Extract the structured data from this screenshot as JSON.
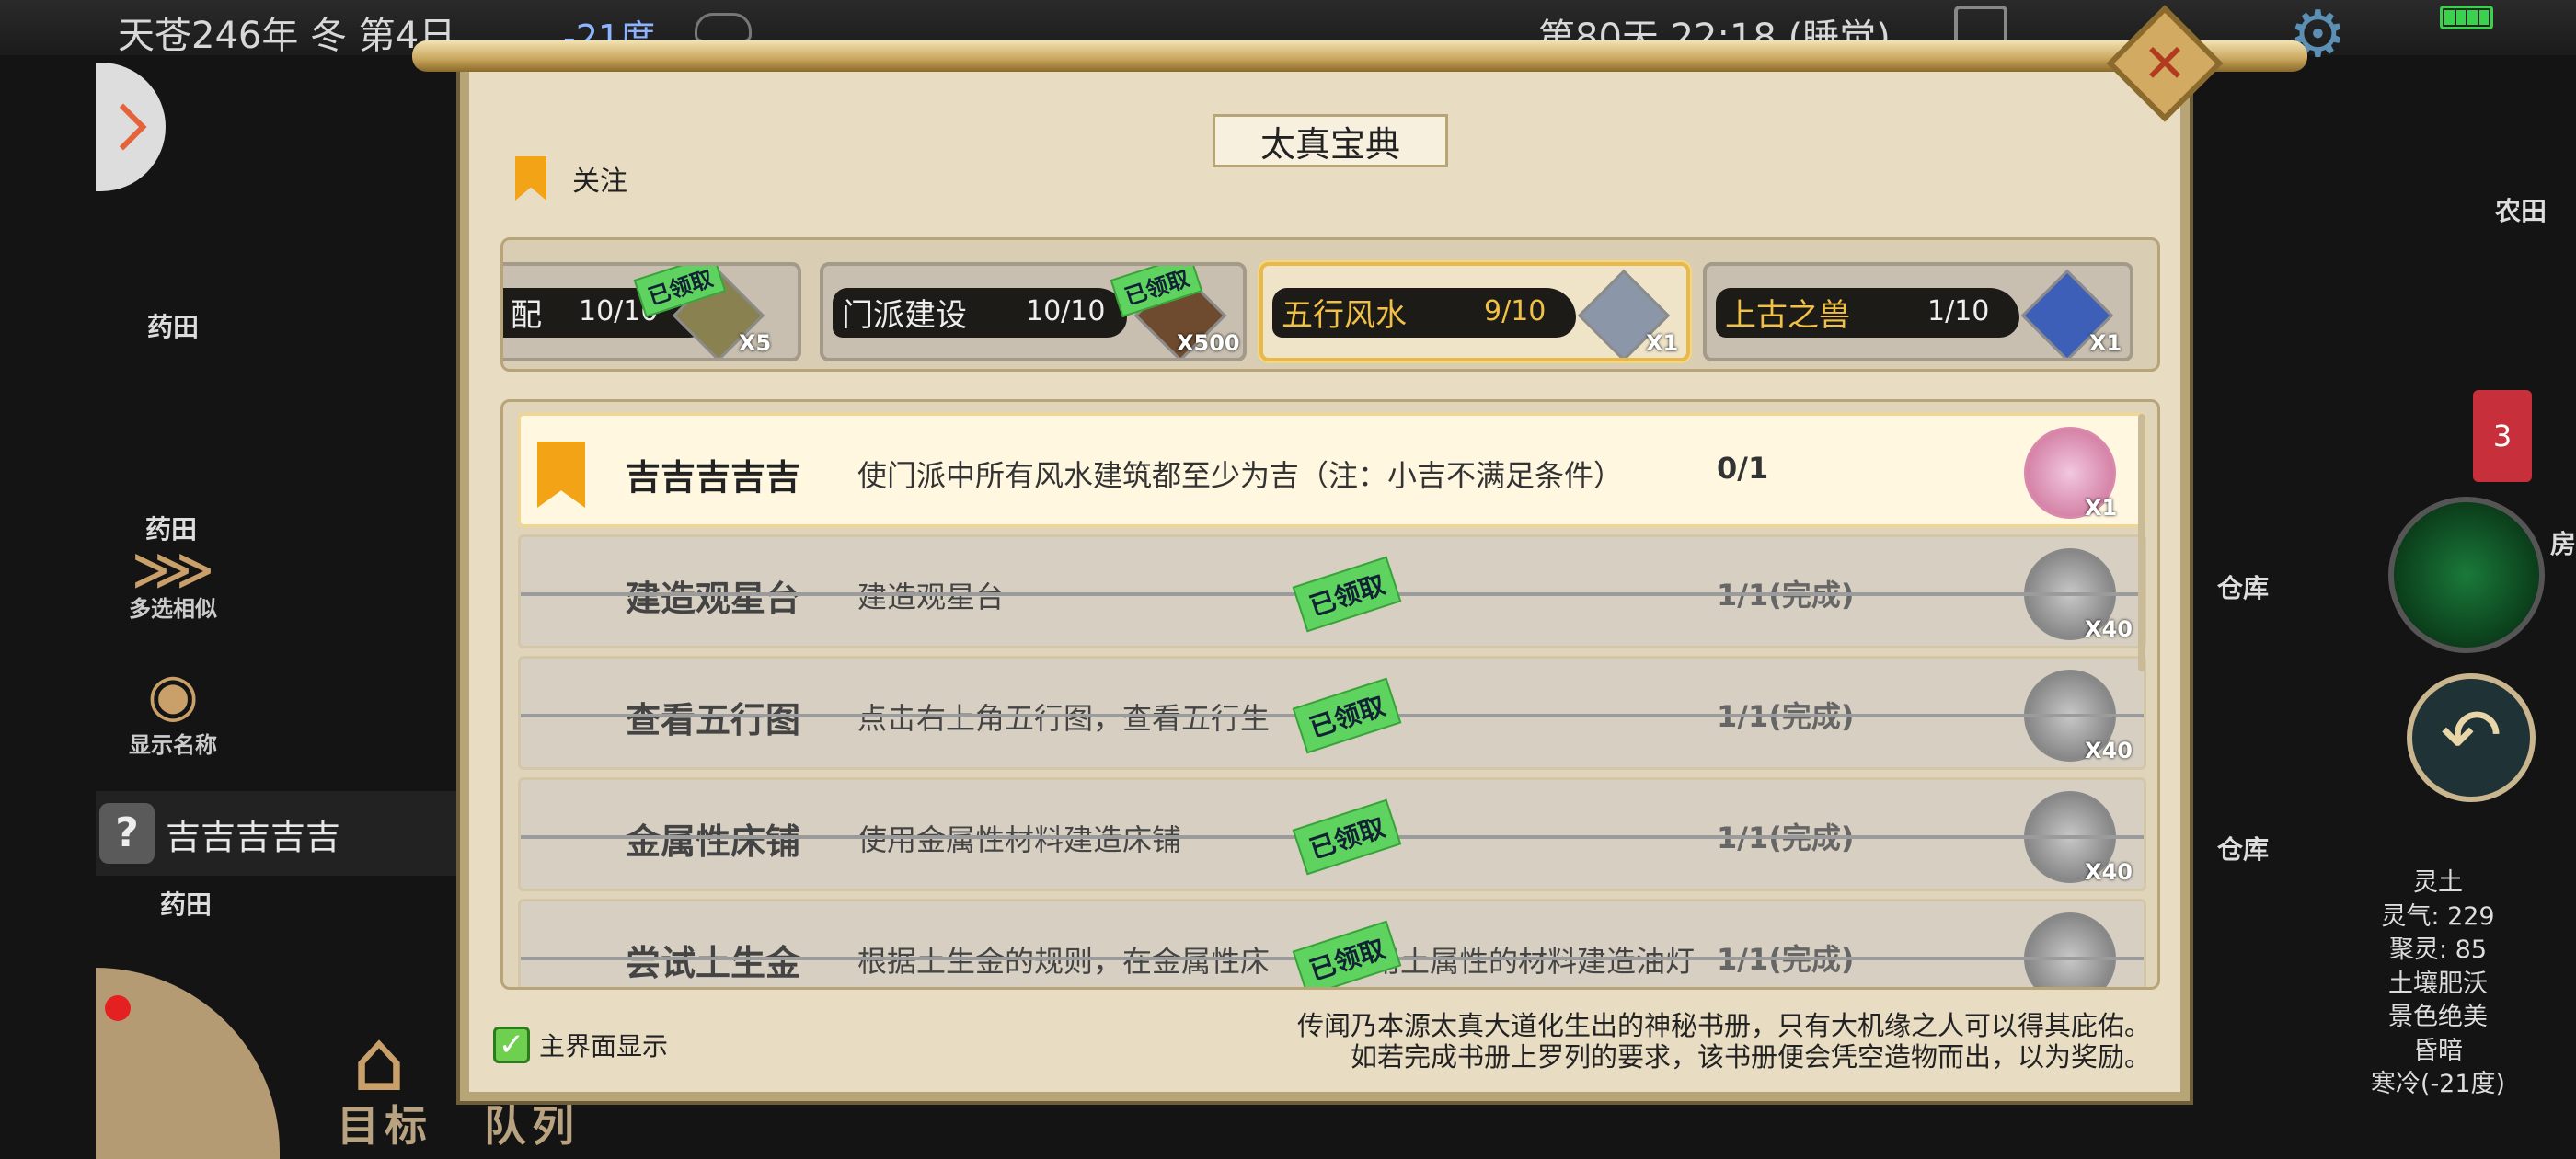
{
  "hud": {
    "date": "天苍246年 冬 第4日",
    "temperature": "-21度",
    "day_time": "第80天 22:18 (睡觉)"
  },
  "left_panel": {
    "labels": [
      "药田",
      "药田",
      "药田"
    ],
    "multi_select_caption": "多选相似",
    "show_names_caption": "显示名称",
    "current_task_badge": "?",
    "current_task": "吉吉吉吉吉",
    "bottom_goal": "目标",
    "bottom_queue": "队列"
  },
  "right_panel": {
    "farm_label": "农田",
    "storage_label_1": "仓库",
    "storage_label_2": "仓库",
    "house_label": "房",
    "notification_count": "3",
    "stats": [
      "灵土",
      "灵气: 229",
      "聚灵: 85",
      "土壤肥沃",
      "景色绝美",
      "昏暗",
      "寒冷(-21度)"
    ]
  },
  "dialog": {
    "title": "太真宝典",
    "follow_label": "关注",
    "categories": [
      {
        "name": "配",
        "progress": "10/10",
        "qty": "X5",
        "claimed": "已领取"
      },
      {
        "name": "门派建设",
        "progress": "10/10",
        "qty": "X500",
        "claimed": "已领取"
      },
      {
        "name": "五行风水",
        "progress": "9/10",
        "qty": "X1"
      },
      {
        "name": "上古之兽",
        "progress": "1/10",
        "qty": "X1"
      }
    ],
    "tasks": [
      {
        "title": "吉吉吉吉吉",
        "desc": "使门派中所有风水建筑都至少为吉（注：小吉不满足条件）",
        "count": "0/1",
        "qty": "X1"
      },
      {
        "title": "建造观星台",
        "desc": "建造观星台",
        "count": "1/1(完成)",
        "qty": "X40",
        "claim": "已领取"
      },
      {
        "title": "查看五行图",
        "desc": "点击右上角五行图，查看五行生",
        "count": "1/1(完成)",
        "qty": "X40",
        "claim": "已领取"
      },
      {
        "title": "金属性床铺",
        "desc": "使用金属性材料建造床铺",
        "count": "1/1(完成)",
        "qty": "X40",
        "claim": "已领取"
      },
      {
        "title": "尝试土生金",
        "desc": "根据土生金的规则，在金属性床",
        "desc_tail": "用土属性的材料建造油灯",
        "count": "1/1(完成)",
        "claim": "已领取"
      }
    ],
    "main_display_label": "主界面显示",
    "footer_line1": "传闻乃本源太真大道化生出的神秘书册，只有大机缘之人可以得其庇佑。",
    "footer_line2": "如若完成书册上罗列的要求，该书册便会凭空造物而出，以为奖励。"
  }
}
